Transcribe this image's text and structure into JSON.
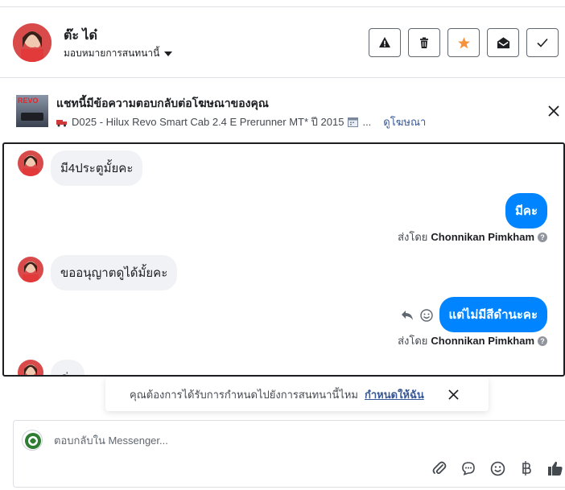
{
  "header": {
    "name": "ต๊ะ ได๋",
    "assign_label": "มอบหมายการสนทนานี้"
  },
  "ad": {
    "thumb_text": "REVO",
    "title": "แชทนี้มีข้อความตอบกลับต่อโฆษณาของคุณ",
    "subtitle": "D025 - Hilux Revo Smart Cab 2.4 E Prerunner MT* ปี 2015",
    "ellipsis": "...",
    "view_ad_label": "ดูโฆษณา"
  },
  "messages": [
    {
      "side": "in",
      "text": "มี4ประตูมั้ยคะ"
    },
    {
      "side": "out",
      "text": "มีคะ",
      "sent_by_prefix": "ส่งโดย",
      "sent_by_name": "Chonnikan Pimkham"
    },
    {
      "side": "in",
      "text": "ขออนุญาตดูได้มั้ยคะ"
    },
    {
      "side": "out",
      "text": "แต่ไม่มีสีดำนะคะ",
      "sent_by_prefix": "ส่งโดย",
      "sent_by_name": "Chonnikan Pimkham"
    },
    {
      "side": "in",
      "text": "ค่ะ"
    }
  ],
  "toast": {
    "text": "คุณต้องการได้รับการกำหนดไปยังการสนทนานี้ไหม",
    "link": "กำหนดให้ฉัน"
  },
  "reply": {
    "placeholder": "ตอบกลับใน Messenger..."
  },
  "icons": {
    "actions": [
      "warning-icon",
      "trash-icon",
      "star-icon",
      "envelope-open-icon",
      "check-icon"
    ],
    "reply_tools": [
      "paperclip-icon",
      "chat-bubble-icon",
      "smiley-icon",
      "baht-icon",
      "thumbs-up-icon"
    ]
  },
  "colors": {
    "accent": "#0084ff",
    "star": "#f7923a",
    "link": "#385898"
  }
}
